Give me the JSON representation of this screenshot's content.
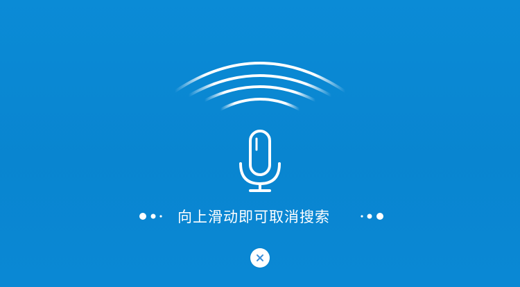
{
  "voice_search": {
    "cancel_hint": "向上滑动即可取消搜索"
  },
  "icons": {
    "microphone": "microphone-icon",
    "sound_waves": "sound-wave-icon",
    "close": "close-icon",
    "dots": "dots-indicator"
  },
  "colors": {
    "background": "#0a87d3",
    "foreground": "#ffffff",
    "close_icon": "#3d8fd9"
  }
}
